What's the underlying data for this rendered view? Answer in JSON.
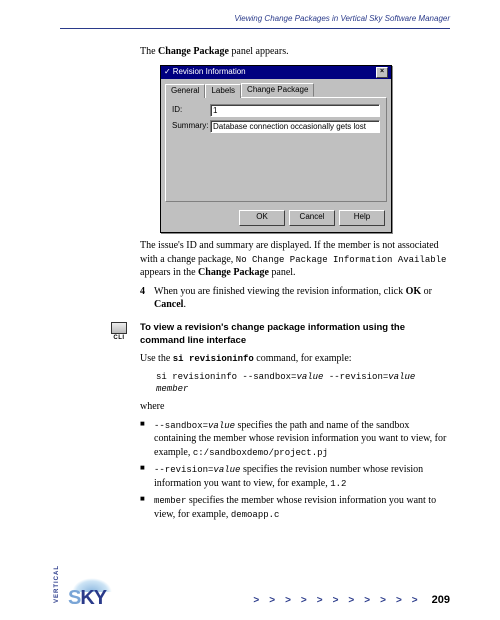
{
  "header": {
    "title": "Viewing Change Packages in Vertical Sky Software Manager"
  },
  "intro": {
    "pre": "The ",
    "bold": "Change Package",
    "post": " panel appears."
  },
  "dialog": {
    "title": "Revision Information",
    "close": "×",
    "tabs": {
      "general": "General",
      "labels": "Labels",
      "change_package": "Change Package"
    },
    "id_label": "ID:",
    "id_value": "1",
    "summary_label": "Summary:",
    "summary_value": "Database connection occasionally gets lost",
    "ok": "OK",
    "cancel": "Cancel",
    "help": "Help"
  },
  "para2": {
    "a": "The issue's ID and summary are displayed. If the member is not associated with a change package, ",
    "code": "No Change Package Information Available",
    "b": " appears in the ",
    "bold": "Change Package",
    "c": " panel."
  },
  "step4": {
    "num": "4",
    "a": "When you are finished viewing the revision information, click ",
    "ok": "OK",
    "or": " or ",
    "cancel": "Cancel",
    "dot": "."
  },
  "cli": {
    "label": "CLI"
  },
  "section_head": "To view a revision's change package information using the command line interface",
  "use_line": {
    "a": "Use the ",
    "cmd": "si revisioninfo",
    "b": " command, for example:"
  },
  "code": {
    "line1": "si revisioninfo --sandbox=",
    "val1": "value",
    "line1b": " --revision=",
    "val2": "value",
    "line2": "member"
  },
  "where": "where",
  "bullets": {
    "b1": {
      "code": "--sandbox=",
      "val": "value",
      "t1": " specifies the path and name of the sandbox containing the member whose revision information you want to view, for example, ",
      "ex": "c:/sandboxdemo/project.pj"
    },
    "b2": {
      "code": "--revision=",
      "val": "value",
      "t1": " specifies the revision number whose revision information you want to view, for example, ",
      "ex": "1.2"
    },
    "b3": {
      "code": "member",
      "t1": " specifies the member whose revision information you want to view, for example, ",
      "ex": "demoapp.c"
    }
  },
  "footer": {
    "vertical": "VERTICAL",
    "sky_s": "S",
    "sky_ky": "KY",
    "chevron": ">",
    "page": "209"
  }
}
